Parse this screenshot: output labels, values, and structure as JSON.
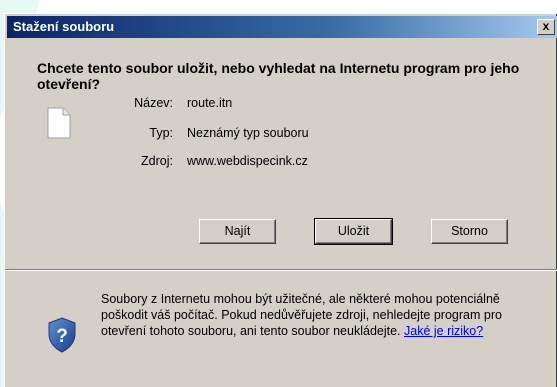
{
  "dialog": {
    "title": "Stažení souboru",
    "close_label": "x",
    "question": "Chcete tento soubor uložit, nebo vyhledat na Internetu program pro jeho otevření?",
    "file": {
      "name_label": "Název:",
      "name_value": "route.itn",
      "type_label": "Typ:",
      "type_value": "Neznámý typ souboru",
      "source_label": "Zdroj:",
      "source_value": "www.webdispecink.cz"
    },
    "buttons": {
      "find": "Najít",
      "save": "Uložit",
      "cancel": "Storno"
    },
    "warning": {
      "text": "Soubory z Internetu mohou být užitečné, ale některé mohou potenciálně poškodit váš počítač. Pokud nedůvěřujete zdroji, nehledejte program pro otevření tohoto souboru, ani tento soubor neukládejte.",
      "link": "Jaké je riziko?"
    }
  },
  "colors": {
    "dialog_bg": "#d4d0c8",
    "title_start": "#0a246a",
    "title_end": "#a6caf0",
    "link": "#0000ee"
  },
  "icons": [
    "file-icon",
    "shield-question-icon",
    "close-icon"
  ]
}
